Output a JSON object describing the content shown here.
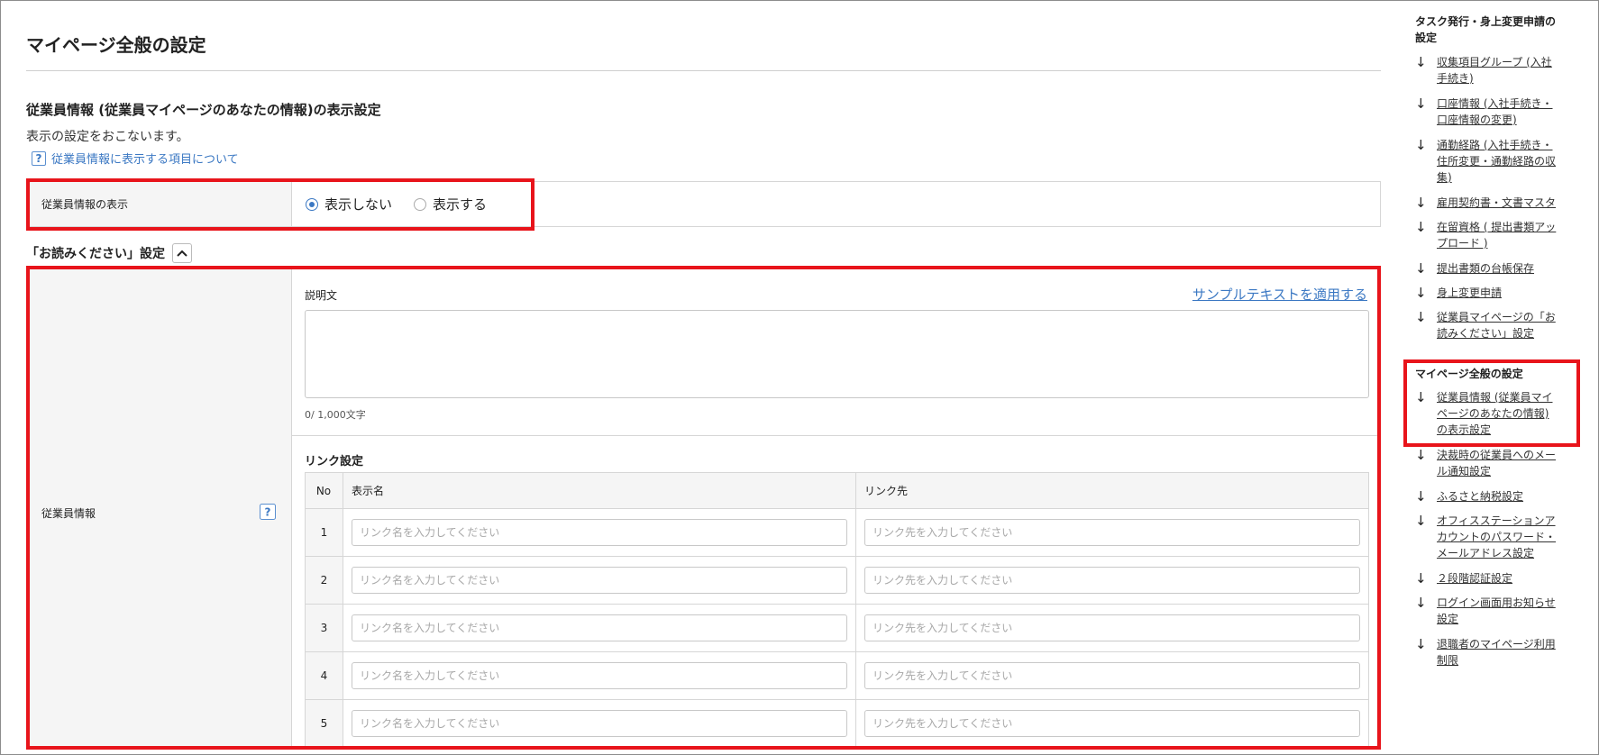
{
  "page_title": "マイページ全般の設定",
  "section": {
    "title": "従業員情報 (従業員マイページのあなたの情報)の表示設定",
    "description": "表示の設定をおこないます。",
    "help_link": "従業員情報に表示する項目について"
  },
  "display_setting": {
    "label": "従業員情報の表示",
    "options": [
      {
        "label": "表示しない",
        "checked": true
      },
      {
        "label": "表示する",
        "checked": false
      }
    ]
  },
  "readme": {
    "header": "「お読みください」設定",
    "collapse_icon": "chevron-up-icon"
  },
  "employee_info": {
    "label": "従業員情報",
    "description_label": "説明文",
    "sample_link": "サンプルテキストを適用する",
    "char_count": "0/ 1,000文字",
    "link_settings_title": "リンク設定",
    "table": {
      "headers": [
        "No",
        "表示名",
        "リンク先"
      ],
      "rows": [
        {
          "no": "1",
          "name_placeholder": "リンク名を入力してください",
          "url_placeholder": "リンク先を入力してください"
        },
        {
          "no": "2",
          "name_placeholder": "リンク名を入力してください",
          "url_placeholder": "リンク先を入力してください"
        },
        {
          "no": "3",
          "name_placeholder": "リンク名を入力してください",
          "url_placeholder": "リンク先を入力してください"
        },
        {
          "no": "4",
          "name_placeholder": "リンク名を入力してください",
          "url_placeholder": "リンク先を入力してください"
        },
        {
          "no": "5",
          "name_placeholder": "リンク名を入力してください",
          "url_placeholder": "リンク先を入力してください"
        }
      ]
    }
  },
  "toc": {
    "group1": {
      "heading_lines": [
        "タスク発行・身上変更申請の",
        "設定"
      ],
      "items": [
        {
          "lines": [
            "収集項目グループ (入社",
            "手続き)"
          ]
        },
        {
          "lines": [
            "口座情報 (入社手続き・",
            "口座情報の変更)"
          ]
        },
        {
          "lines": [
            "通勤経路 (入社手続き・",
            "住所変更・通勤経路の収",
            "集)"
          ]
        },
        {
          "lines": [
            "雇用契約書・文書マスタ"
          ]
        },
        {
          "lines": [
            "在留資格 ( 提出書類アッ",
            "プロード )"
          ]
        },
        {
          "lines": [
            "提出書類の台帳保存"
          ]
        },
        {
          "lines": [
            "身上変更申請"
          ]
        },
        {
          "lines": [
            "従業員マイページの「お",
            "読みください」設定"
          ]
        }
      ]
    },
    "group2": {
      "heading_lines": [
        "マイページ全般の設定"
      ],
      "items": [
        {
          "lines": [
            "従業員情報 (従業員マイ",
            "ページのあなたの情報)",
            "の表示設定"
          ]
        },
        {
          "lines": [
            "決裁時の従業員へのメー",
            "ル通知設定"
          ]
        },
        {
          "lines": [
            "ふるさと納税設定"
          ]
        },
        {
          "lines": [
            "オフィスステーションア",
            "カウントのパスワード・",
            "メールアドレス設定"
          ]
        },
        {
          "lines": [
            "２段階認証設定"
          ]
        },
        {
          "lines": [
            "ログイン画面用お知らせ",
            "設定"
          ]
        },
        {
          "lines": [
            "退職者のマイページ利用",
            "制限"
          ]
        }
      ]
    },
    "arrow_icon": "arrow-down-icon"
  },
  "colors": {
    "accent": "#3b78c3",
    "highlight": "#e8141b",
    "label_bg": "#f5f5f5",
    "border": "#d6d6d6"
  }
}
